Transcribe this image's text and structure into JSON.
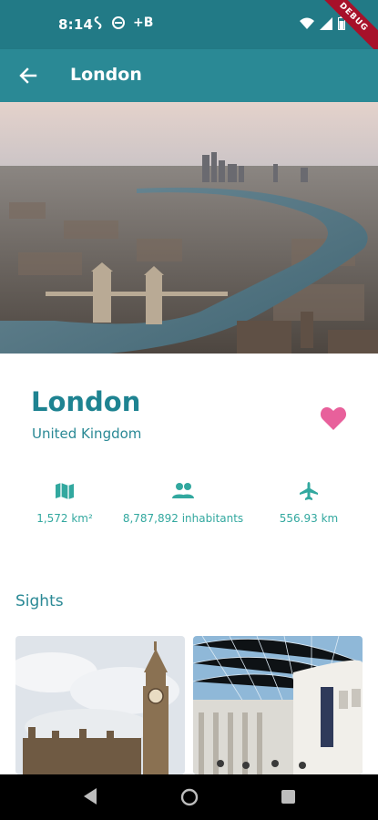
{
  "status": {
    "time": "8:14",
    "indicator": "+B",
    "debug": "DEBUG"
  },
  "app_bar": {
    "title": "London",
    "back_icon": "arrow-left-icon"
  },
  "city": {
    "name": "London",
    "country": "United Kingdom",
    "favorite": true
  },
  "stats": [
    {
      "icon": "map-icon",
      "label": "1,572 km²"
    },
    {
      "icon": "people-icon",
      "label": "8,787,892 inhabitants"
    },
    {
      "icon": "airplane-icon",
      "label": "556.93 km"
    }
  ],
  "sights": {
    "title": "Sights"
  },
  "colors": {
    "primary": "#2a8995",
    "status_bar": "#227a86",
    "accent_heart": "#e8609b",
    "stat_teal": "#32a89f"
  }
}
